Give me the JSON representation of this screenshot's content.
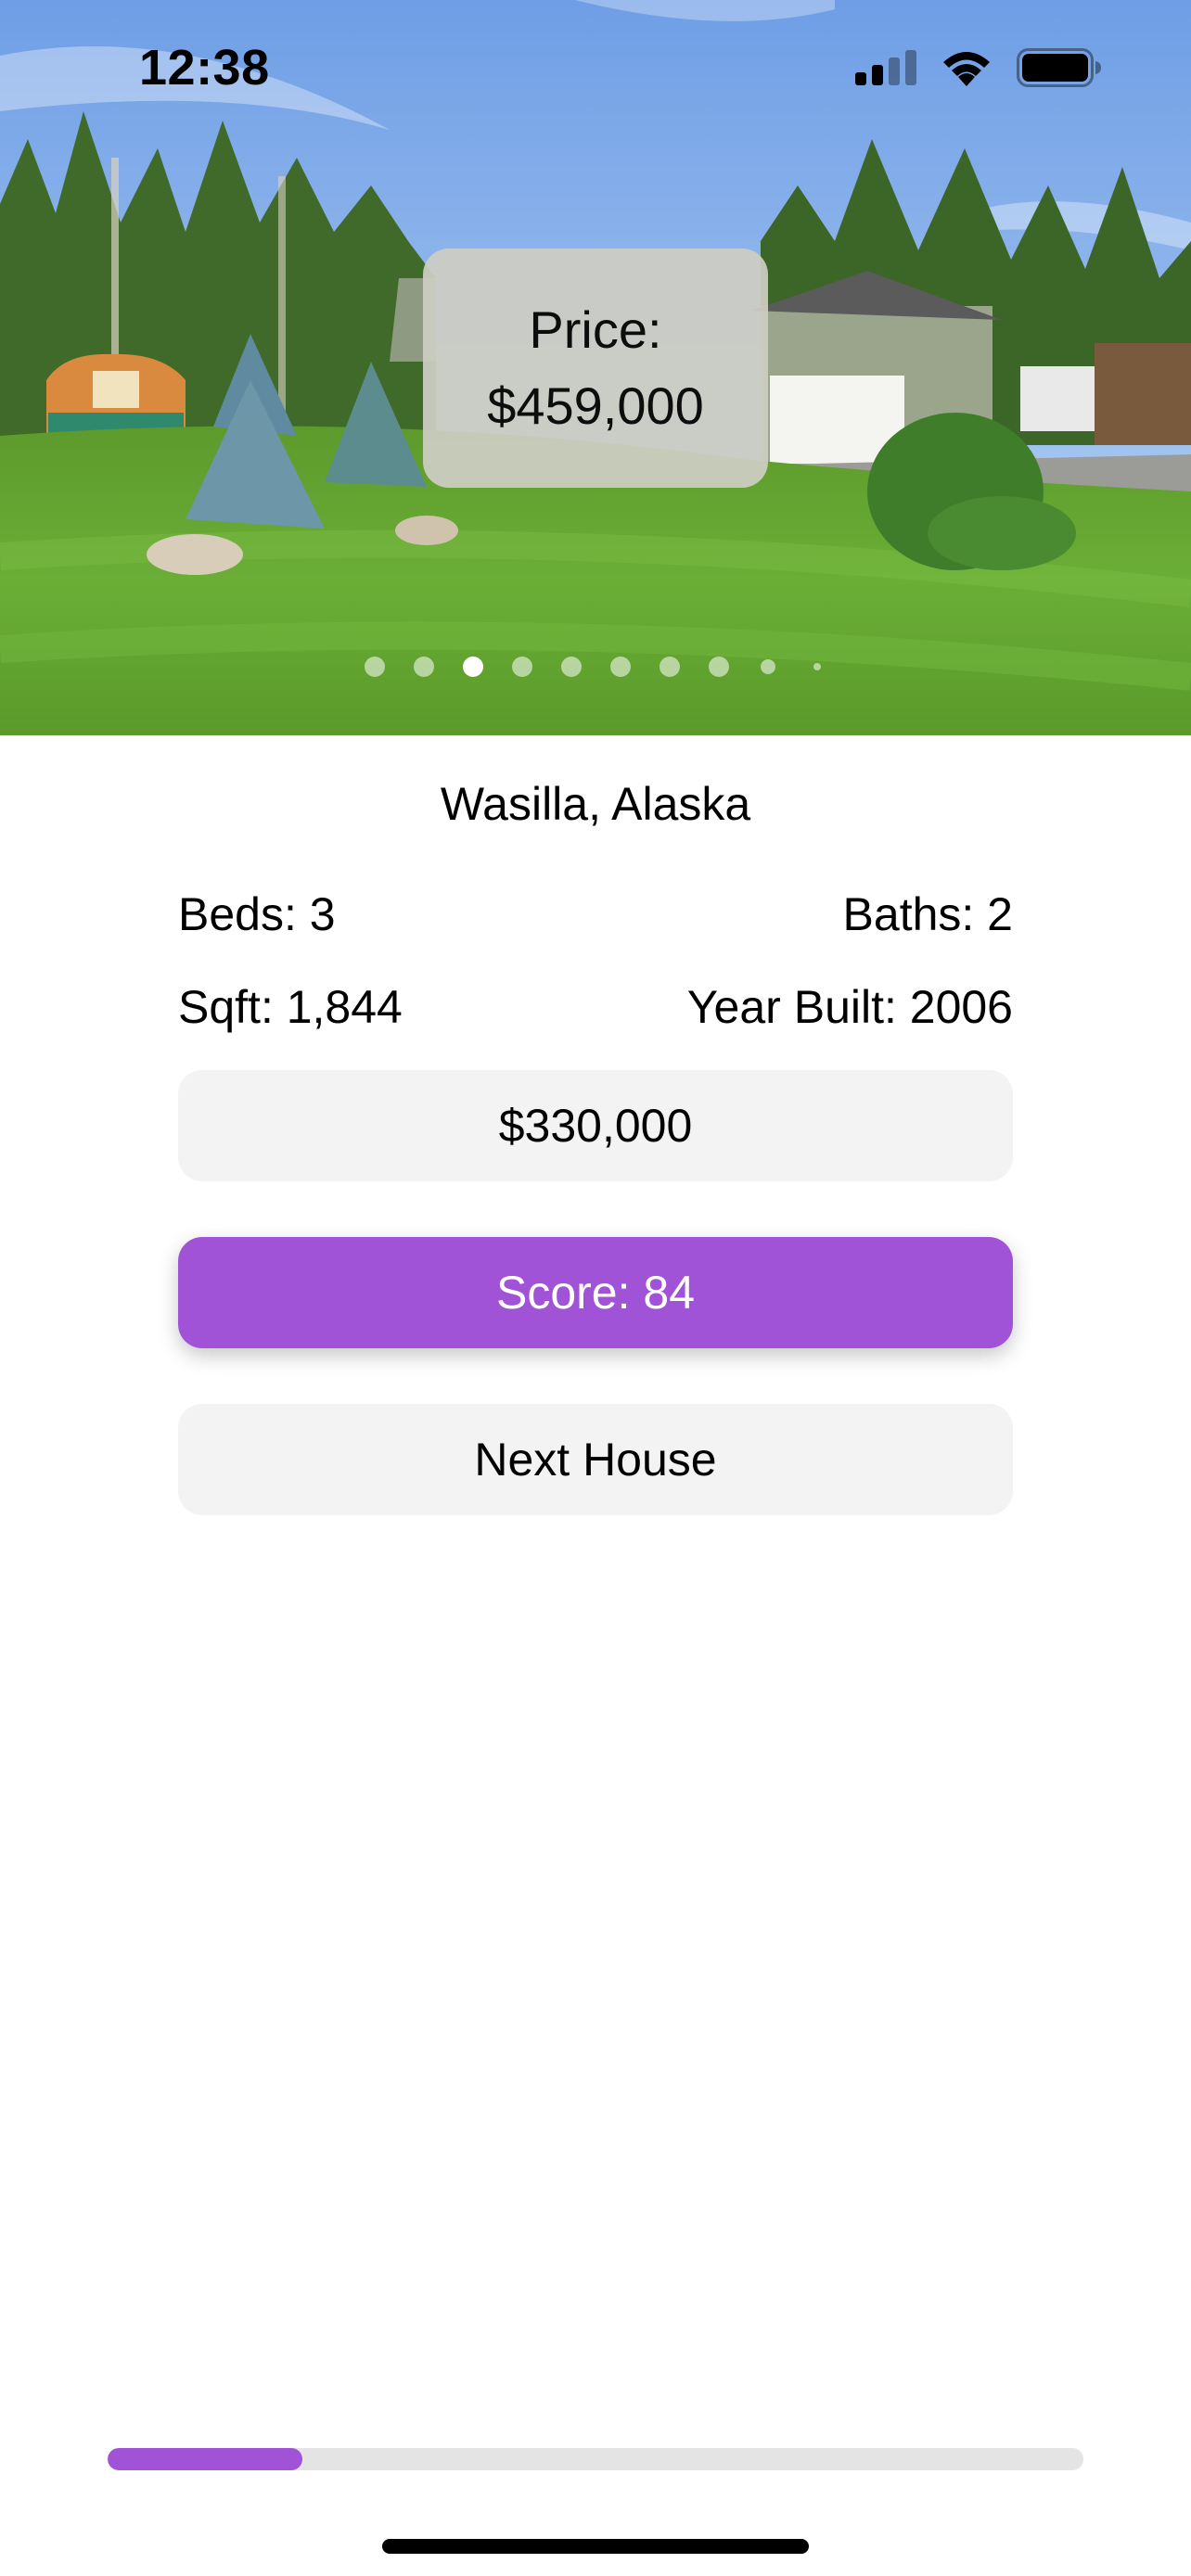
{
  "status_bar": {
    "time": "12:38",
    "icons": [
      "cellular-signal-icon",
      "wifi-icon",
      "battery-icon"
    ]
  },
  "listing": {
    "photo_alt": "house-photo",
    "price_label": "Price:",
    "price_value": "$459,000",
    "photo_count": 10,
    "current_photo_index": 2,
    "location": "Wasilla, Alaska",
    "beds": "Beds: 3",
    "baths": "Baths: 2",
    "sqft": "Sqft: 1,844",
    "year_built": "Year Built: 2006"
  },
  "guess": {
    "value": "$330,000"
  },
  "score_button": {
    "label": "Score: 84"
  },
  "next_button": {
    "label": "Next House"
  },
  "progress": {
    "fraction": 0.2
  },
  "colors": {
    "accent": "#a053d6",
    "pill_background": "#f3f3f3",
    "progress_track": "#e4e4e4"
  }
}
